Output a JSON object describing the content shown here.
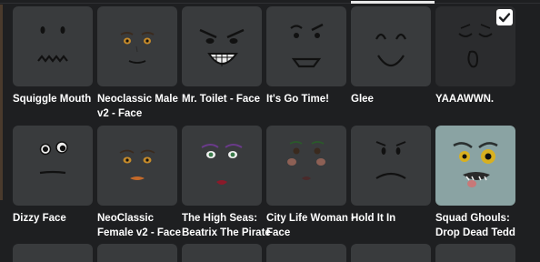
{
  "items": [
    {
      "name": "Squiggle Mouth",
      "selected": false
    },
    {
      "name": "Neoclassic Male v2 - Face",
      "selected": false
    },
    {
      "name": "Mr. Toilet - Face",
      "selected": false
    },
    {
      "name": "It's Go Time!",
      "selected": false
    },
    {
      "name": "Glee",
      "selected": false
    },
    {
      "name": "YAAAWWN.",
      "selected": true
    },
    {
      "name": "Dizzy Face",
      "selected": false
    },
    {
      "name": "NeoClassic Female v2 - Face",
      "selected": false
    },
    {
      "name": "The High Seas: Beatrix The Pirate",
      "selected": false
    },
    {
      "name": "City Life Woman - Face",
      "selected": false
    },
    {
      "name": "Hold It In",
      "selected": false
    },
    {
      "name": "Squad Ghouls: Drop Dead Tedd",
      "selected": false
    }
  ],
  "icons": {
    "check": "checkmark-icon"
  }
}
